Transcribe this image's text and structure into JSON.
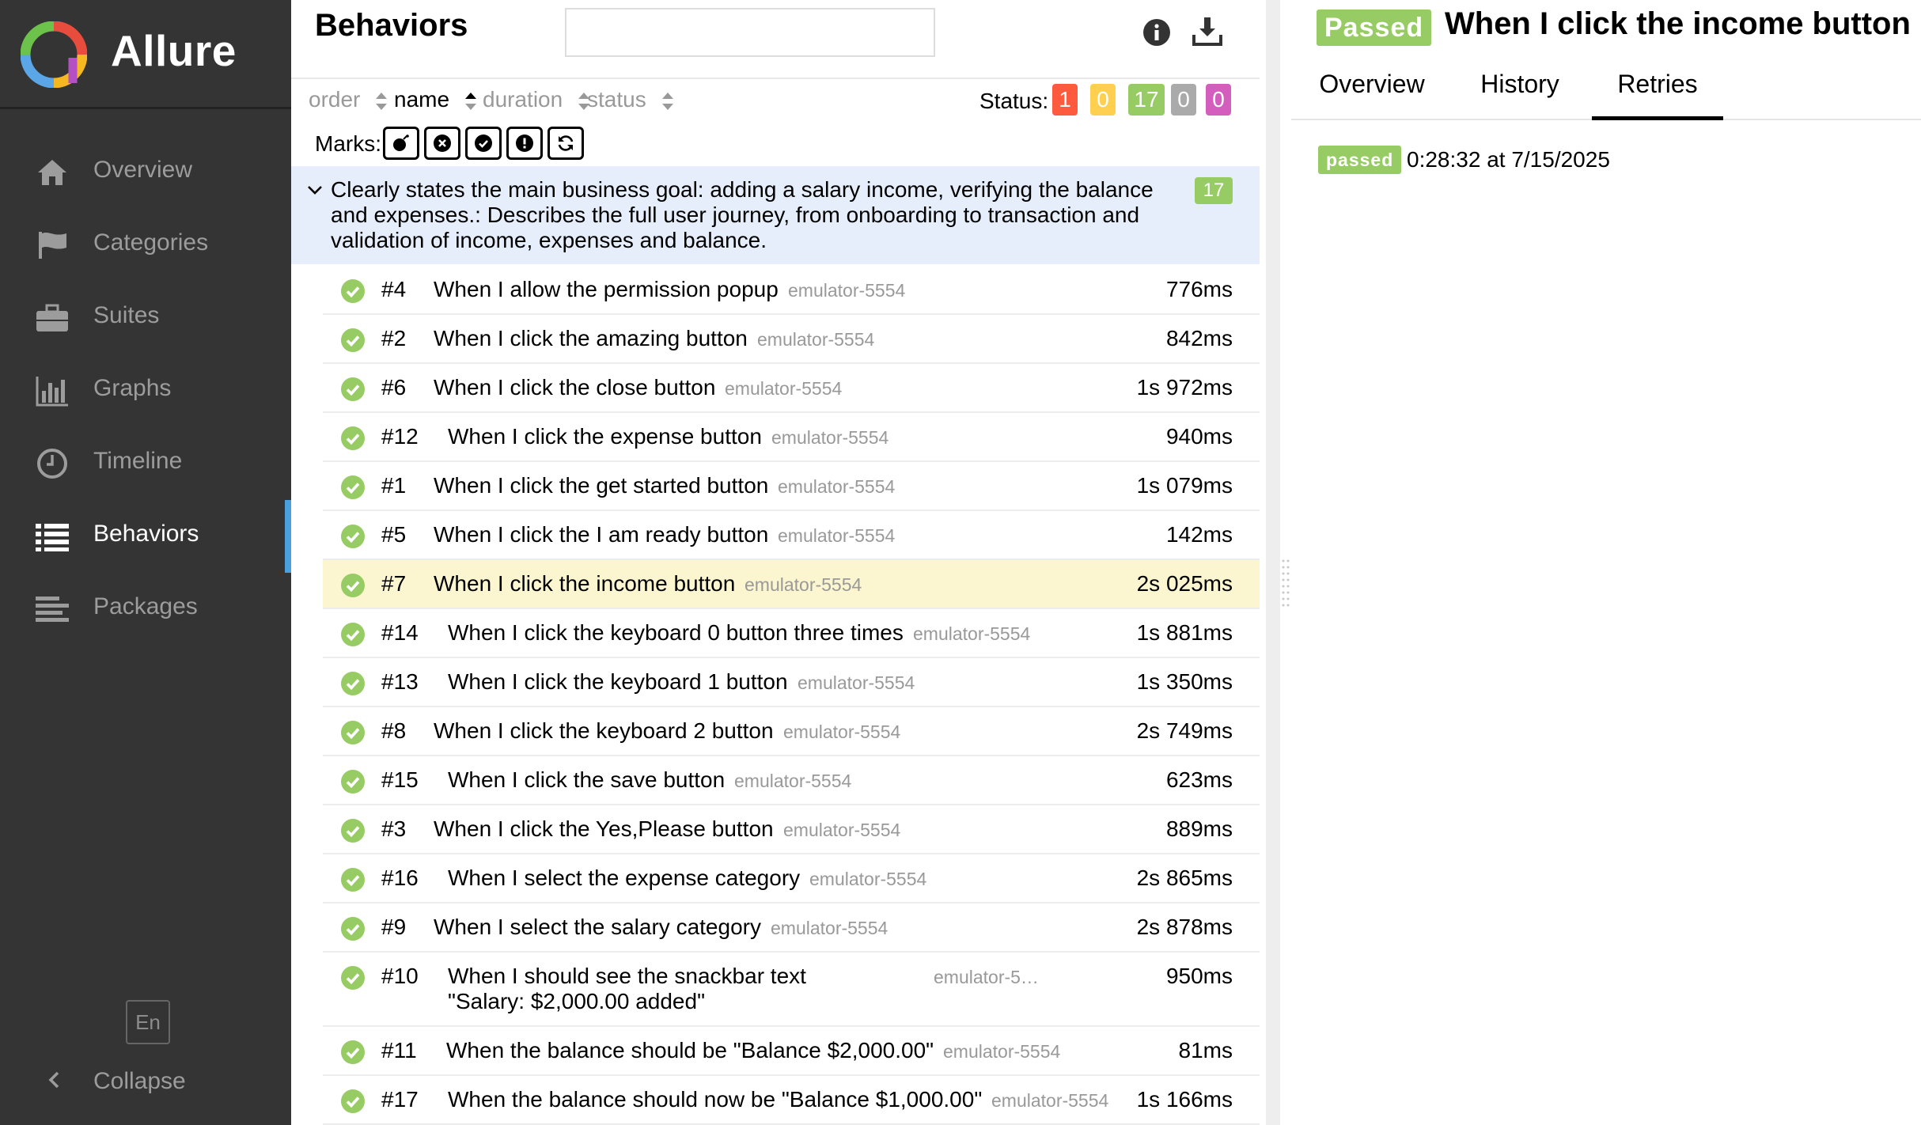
{
  "app": {
    "name": "Allure"
  },
  "sidebar": {
    "items": [
      {
        "label": "Overview",
        "icon": "home-icon"
      },
      {
        "label": "Categories",
        "icon": "flag-icon"
      },
      {
        "label": "Suites",
        "icon": "briefcase-icon"
      },
      {
        "label": "Graphs",
        "icon": "bar-chart-icon"
      },
      {
        "label": "Timeline",
        "icon": "clock-icon"
      },
      {
        "label": "Behaviors",
        "icon": "list-icon",
        "active": true
      },
      {
        "label": "Packages",
        "icon": "align-left-icon"
      }
    ],
    "language": "En",
    "collapse_label": "Collapse"
  },
  "behaviors": {
    "title": "Behaviors",
    "search_value": "",
    "sort": {
      "order": "order",
      "name": "name",
      "duration": "duration",
      "status": "status"
    },
    "status_label": "Status:",
    "status_counts": [
      {
        "value": "1",
        "color": "#fd5a3e"
      },
      {
        "value": "0",
        "color": "#ffd050"
      },
      {
        "value": "17",
        "color": "#97cc64"
      },
      {
        "value": "0",
        "color": "#aaaaaa"
      },
      {
        "value": "0",
        "color": "#d35ebe"
      }
    ],
    "marks_label": "Marks:",
    "marks": [
      "flaky-bomb-icon",
      "new-failed-icon",
      "new-passed-icon",
      "new-broken-icon",
      "retries-icon"
    ],
    "group": {
      "text": "Clearly states the main business goal: adding a salary income, verifying the balance and expenses.: Describes the full user journey, from onboarding to transaction and validation of income, expenses and balance.",
      "count": "17"
    },
    "rows": [
      {
        "num": "#4",
        "name": "When I allow the permission popup",
        "host": "emulator-5554",
        "duration": "776ms"
      },
      {
        "num": "#2",
        "name": "When I click the amazing button",
        "host": "emulator-5554",
        "duration": "842ms"
      },
      {
        "num": "#6",
        "name": "When I click the close button",
        "host": "emulator-5554",
        "duration": "1s 972ms"
      },
      {
        "num": "#12",
        "name": "When I click the expense button",
        "host": "emulator-5554",
        "duration": "940ms"
      },
      {
        "num": "#1",
        "name": "When I click the get started button",
        "host": "emulator-5554",
        "duration": "1s 079ms"
      },
      {
        "num": "#5",
        "name": "When I click the I am ready button",
        "host": "emulator-5554",
        "duration": "142ms"
      },
      {
        "num": "#7",
        "name": "When I click the income button",
        "host": "emulator-5554",
        "duration": "2s 025ms",
        "selected": true
      },
      {
        "num": "#14",
        "name": "When I click the keyboard 0 button three times",
        "host": "emulator-5554",
        "duration": "1s 881ms"
      },
      {
        "num": "#13",
        "name": "When I click the keyboard 1 button",
        "host": "emulator-5554",
        "duration": "1s 350ms"
      },
      {
        "num": "#8",
        "name": "When I click the keyboard 2 button",
        "host": "emulator-5554",
        "duration": "2s 749ms"
      },
      {
        "num": "#15",
        "name": "When I click the save button",
        "host": "emulator-5554",
        "duration": "623ms"
      },
      {
        "num": "#3",
        "name": "When I click the Yes,Please button",
        "host": "emulator-5554",
        "duration": "889ms"
      },
      {
        "num": "#16",
        "name": "When I select the expense category",
        "host": "emulator-5554",
        "duration": "2s 865ms"
      },
      {
        "num": "#9",
        "name": "When I select the salary category",
        "host": "emulator-5554",
        "duration": "2s 878ms"
      },
      {
        "num": "#10",
        "name": "When I should see the snackbar text \"Salary: $2,000.00 added\"",
        "host": "emulator-5…",
        "duration": "950ms",
        "tall": true
      },
      {
        "num": "#11",
        "name": "When the balance should be \"Balance $2,000.00\"",
        "host": "emulator-5554",
        "duration": "81ms"
      },
      {
        "num": "#17",
        "name": "When the balance should now be \"Balance $1,000.00\"",
        "host": "emulator-5554",
        "duration": "1s 166ms"
      }
    ]
  },
  "detail": {
    "status": "Passed",
    "title": "When I click the income button",
    "tabs": [
      "Overview",
      "History",
      "Retries"
    ],
    "active_tab": "Retries",
    "retry": {
      "status": "passed",
      "time": "0:28:32 at 7/15/2025"
    }
  },
  "colors": {
    "passed": "#97cc64",
    "sidebar": "#343434",
    "accent": "#4aa0dc",
    "selected_row": "#fbf6cf",
    "group_bg": "#e6eefc"
  }
}
